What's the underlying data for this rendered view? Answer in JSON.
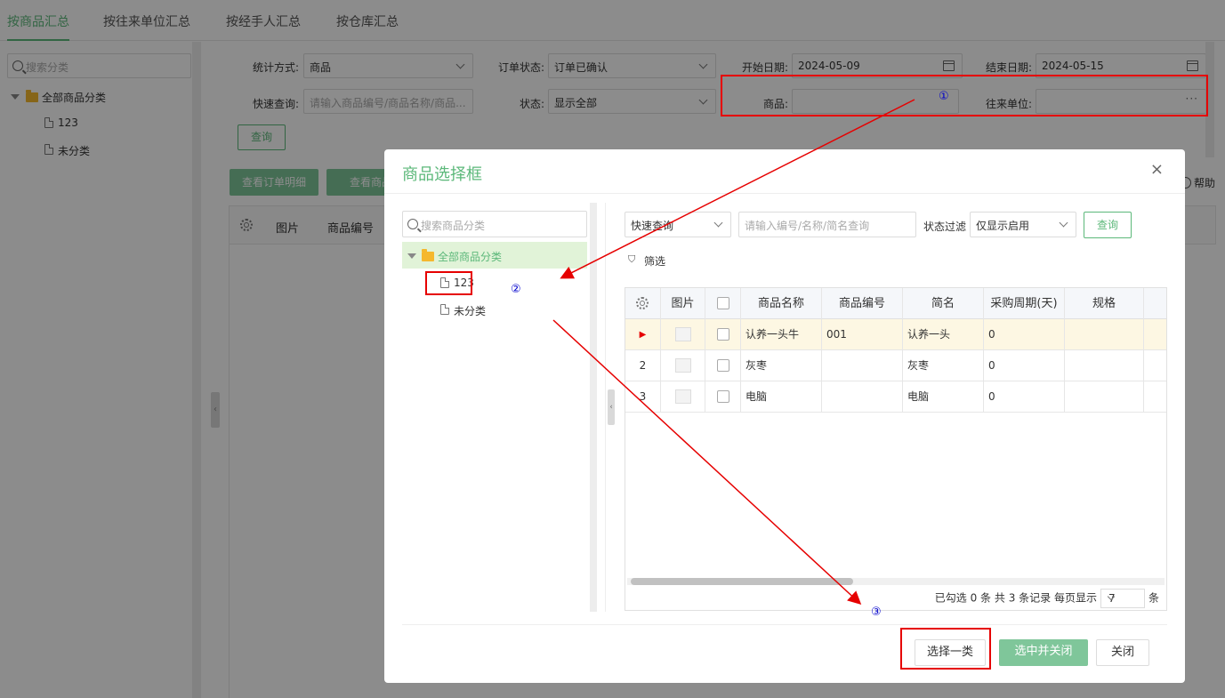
{
  "tabs": [
    "按商品汇总",
    "按往来单位汇总",
    "按经手人汇总",
    "按仓库汇总"
  ],
  "sidebar": {
    "search_placeholder": "搜索分类",
    "root": "全部商品分类",
    "children": [
      "123",
      "未分类"
    ]
  },
  "filters": {
    "stat_method_label": "统计方式:",
    "stat_method_value": "商品",
    "order_status_label": "订单状态:",
    "order_status_value": "订单已确认",
    "start_date_label": "开始日期:",
    "start_date_value": "2024-05-09",
    "end_date_label": "结束日期:",
    "end_date_value": "2024-05-15",
    "quick_query_label": "快速查询:",
    "quick_query_placeholder": "请输入商品编号/商品名称/商品...",
    "status_label": "状态:",
    "status_value": "显示全部",
    "product_label": "商品:",
    "partner_label": "往来单位:",
    "query_button": "查询"
  },
  "toolbar": {
    "order_detail": "查看订单明细",
    "view_product": "查看商品",
    "help": "帮助"
  },
  "main_table": {
    "headers": [
      "图片",
      "商品编号"
    ]
  },
  "modal": {
    "title": "商品选择框",
    "tree_search_placeholder": "搜索商品分类",
    "tree_root": "全部商品分类",
    "tree_children": [
      "123",
      "未分类"
    ],
    "quick_query_select": "快速查询",
    "search_placeholder": "请输入编号/名称/简名查询",
    "status_filter_label": "状态过滤",
    "status_filter_value": "仅显示启用",
    "query_button": "查询",
    "filter_label": "筛选",
    "grid_headers": [
      "图片",
      "商品名称",
      "商品编号",
      "简名",
      "采购周期(天)",
      "规格"
    ],
    "rows": [
      {
        "index": "",
        "name": "认养一头牛",
        "code": "001",
        "short": "认养一头",
        "cycle": "0",
        "spec": ""
      },
      {
        "index": "2",
        "name": "灰枣",
        "code": "",
        "short": "灰枣",
        "cycle": "0",
        "spec": ""
      },
      {
        "index": "3",
        "name": "电脑",
        "code": "",
        "short": "电脑",
        "cycle": "0",
        "spec": ""
      }
    ],
    "pager": {
      "selected": "已勾选 0 条",
      "total": "共 3 条记录",
      "per_page_label": "每页显示",
      "per_page_value": "7",
      "unit": "条"
    },
    "buttons": {
      "select_category": "选择一类",
      "select_close": "选中并关闭",
      "close": "关闭"
    }
  },
  "annotations": {
    "step1": "①",
    "step2": "②",
    "step3": "③"
  },
  "colors": {
    "accent": "#5cb87a",
    "annotation": "#e60000"
  }
}
